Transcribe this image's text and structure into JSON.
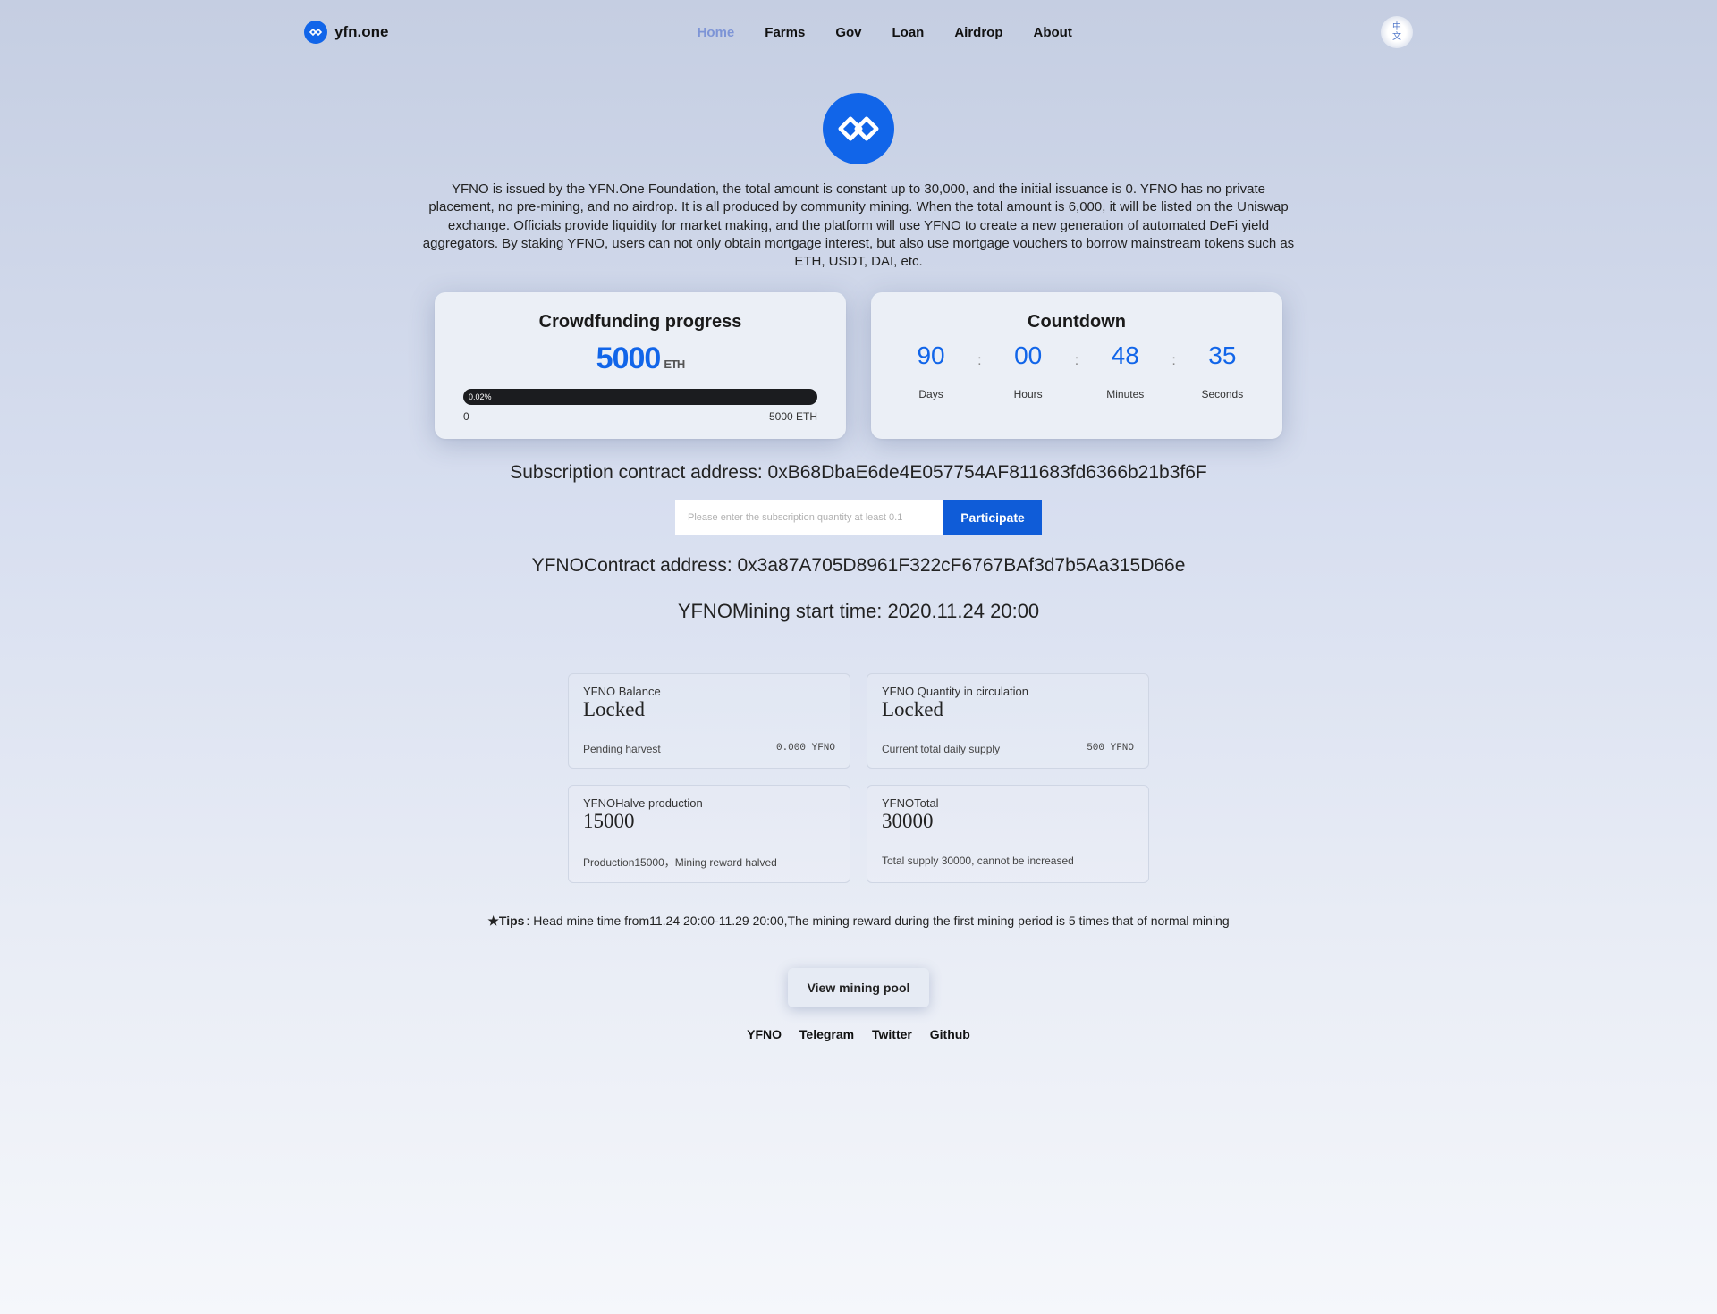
{
  "brand": "yfn.one",
  "lang": {
    "l1": "中",
    "l2": "文"
  },
  "nav": {
    "home": "Home",
    "farms": "Farms",
    "gov": "Gov",
    "loan": "Loan",
    "airdrop": "Airdrop",
    "about": "About"
  },
  "description": "YFNO is issued by the YFN.One Foundation, the total amount is constant up to 30,000, and the initial issuance is 0. YFNO has no private placement, no pre-mining, and no airdrop. It is all produced by community mining. When the total amount is 6,000, it will be listed on the Uniswap exchange. Officials provide liquidity for market making, and the platform will use YFNO to create a new generation of automated DeFi yield aggregators. By staking YFNO, users can not only obtain mortgage interest, but also use mortgage vouchers to borrow mainstream tokens such as ETH, USDT, DAI, etc.",
  "crowdfunding": {
    "title": "Crowdfunding progress",
    "amount": "5000",
    "unit": "ETH",
    "pct": "0.02%",
    "min": "0",
    "max": "5000 ETH"
  },
  "countdown": {
    "title": "Countdown",
    "days": "90",
    "days_lbl": "Days",
    "hours": "00",
    "hours_lbl": "Hours",
    "minutes": "48",
    "minutes_lbl": "Minutes",
    "seconds": "35",
    "seconds_lbl": "Seconds"
  },
  "sub_addr": "Subscription contract address: 0xB68DbaE6de4E057754AF811683fd6366b21b3f6F",
  "sub_placeholder": "Please enter the subscription quantity at least 0.1",
  "participate": "Participate",
  "contract_addr": "YFNOContract address: 0x3a87A705D8961F322cF6767BAf3d7b5Aa315D66e",
  "mining_time": "YFNOMining start time: 2020.11.24 20:00",
  "stats": {
    "balance": {
      "title": "YFNO Balance",
      "value": "Locked",
      "sub_label": "Pending harvest",
      "sub_value": "0.000 YFNO"
    },
    "circ": {
      "title": "YFNO Quantity in circulation",
      "value": "Locked",
      "sub_label": "Current total daily supply",
      "sub_value": "500 YFNO"
    },
    "halve": {
      "title": "YFNOHalve production",
      "value": "15000",
      "sub_label": "Production15000，Mining reward halved",
      "sub_value": ""
    },
    "total": {
      "title": "YFNOTotal",
      "value": "30000",
      "sub_label": "Total supply 30000, cannot be increased",
      "sub_value": ""
    }
  },
  "tips_label": "★Tips",
  "tips_text": ": Head mine time from11.24 20:00-11.29 20:00,The mining reward during the first mining period is 5 times that of normal mining",
  "view_pool": "View mining pool",
  "footer": {
    "yfno": "YFNO",
    "telegram": "Telegram",
    "twitter": "Twitter",
    "github": "Github"
  }
}
